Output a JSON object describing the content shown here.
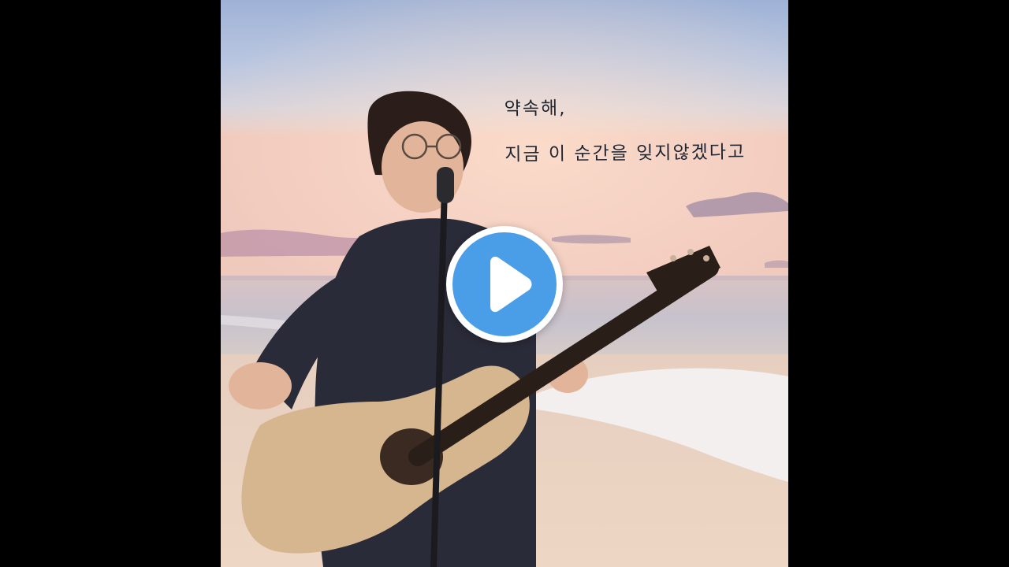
{
  "player": {
    "caption_line1": "약속해,",
    "caption_line2": "지금 이 순간을 잊지않겠다고",
    "play_icon": "play-icon",
    "accent_color": "#4a9ee8"
  }
}
